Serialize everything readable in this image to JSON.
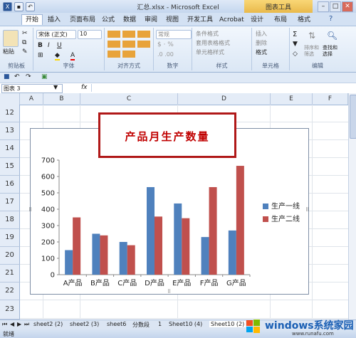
{
  "window": {
    "title": "汇总.xlsx - Microsoft Excel",
    "context_tab_group": "图表工具",
    "accent": "#2b579a"
  },
  "tabs": [
    {
      "label": "开始",
      "active": true
    },
    {
      "label": "插入"
    },
    {
      "label": "页面布局"
    },
    {
      "label": "公式"
    },
    {
      "label": "数据"
    },
    {
      "label": "审阅"
    },
    {
      "label": "视图"
    },
    {
      "label": "开发工具"
    },
    {
      "label": "Acrobat"
    },
    {
      "label": "设计"
    },
    {
      "label": "布局"
    },
    {
      "label": "格式"
    }
  ],
  "ribbon": {
    "paste_label": "粘贴",
    "font_name": "宋体 (正文)",
    "font_size": "10",
    "number_format": "常规",
    "conditional_format": "条件格式",
    "table_format": "套用表格格式",
    "cell_style": "单元格样式",
    "insert": "插入",
    "delete": "删除",
    "format": "格式",
    "sort_filter": "排序和\n筛选",
    "find_select": "查找和\n选择",
    "groups": [
      "剪贴板",
      "字体",
      "对齐方式",
      "数字",
      "样式",
      "单元格",
      "编辑"
    ]
  },
  "formula_bar": {
    "name_box": "图表 3",
    "fx": "fx",
    "formula": ""
  },
  "columns": [
    "A",
    "B",
    "C",
    "D",
    "E",
    "F"
  ],
  "rows": [
    "12",
    "13",
    "14",
    "15",
    "16",
    "17",
    "18",
    "19",
    "20",
    "21",
    "22",
    "23"
  ],
  "chart_data": {
    "type": "bar",
    "title": "产品月生产数量",
    "categories": [
      "A产品",
      "B产品",
      "C产品",
      "D产品",
      "E产品",
      "F产品",
      "G产品"
    ],
    "series": [
      {
        "name": "生产一线",
        "values": [
          150,
          250,
          200,
          535,
          435,
          230,
          270
        ],
        "color": "#4f81bd"
      },
      {
        "name": "生产二线",
        "values": [
          350,
          240,
          180,
          355,
          345,
          535,
          665
        ],
        "color": "#c0504d"
      }
    ],
    "ylim": [
      0,
      700
    ],
    "yticks": [
      0,
      100,
      200,
      300,
      400,
      500,
      600,
      700
    ],
    "legend_position": "right"
  },
  "sheet_tabs": [
    "sheet2 (2)",
    "sheet2 (3)",
    "sheet6",
    "分数段",
    "1",
    "Sheet10 (4)",
    "Sheet10 (2)"
  ],
  "status": {
    "mode": "就绪"
  },
  "watermark": {
    "text": "windows系统家园",
    "url": "www.runafu.com"
  }
}
